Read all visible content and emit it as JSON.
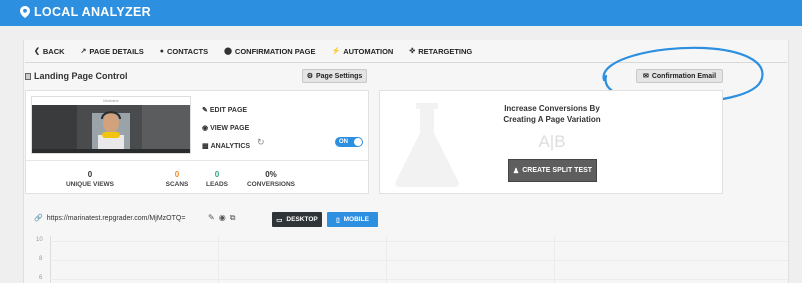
{
  "app": {
    "title": "LOCAL ANALYZER",
    "icon": "map-pin-icon"
  },
  "nav": {
    "items": [
      {
        "label": "BACK",
        "icon": "chevron-left-icon"
      },
      {
        "label": "PAGE DETAILS",
        "icon": "line-chart-icon"
      },
      {
        "label": "CONTACTS",
        "icon": "user-icon"
      },
      {
        "label": "CONFIRMATION PAGE",
        "icon": "circle-icon"
      },
      {
        "label": "AUTOMATION",
        "icon": "bolt-icon"
      },
      {
        "label": "RETARGETING",
        "icon": "crosshair-icon"
      }
    ]
  },
  "section": {
    "title": "Landing Page Control",
    "page_settings_label": "Page Settings",
    "confirmation_email_label": "Confirmation Email"
  },
  "landing": {
    "thumbnail_header": "Markabe",
    "actions": {
      "edit": "EDIT PAGE",
      "view": "VIEW PAGE",
      "analytics": "ANALYTICS"
    },
    "toggle_label": "ON",
    "stats": [
      {
        "value": "0",
        "label": "UNIQUE VIEWS",
        "color": "#333333"
      },
      {
        "value": "0",
        "label": "SCANS",
        "color": "#f28c28"
      },
      {
        "value": "0",
        "label": "LEADS",
        "color": "#2aa88a"
      },
      {
        "value": "0%",
        "label": "CONVERSIONS",
        "color": "#333333"
      }
    ]
  },
  "split": {
    "title_line1": "Increase Conversions By",
    "title_line2": "Creating A Page Variation",
    "ab_text": "A|B",
    "button_label": "CREATE SPLIT TEST"
  },
  "preview": {
    "url": "https://marinatest.repgrader.com/MjMzOTQ=",
    "desktop_label": "DESKTOP",
    "mobile_label": "MOBILE"
  },
  "chart": {
    "y_ticks": [
      "10",
      "8",
      "6",
      "4"
    ]
  },
  "colors": {
    "brand": "#2d8fe0",
    "annotation": "#2d8fe0"
  }
}
